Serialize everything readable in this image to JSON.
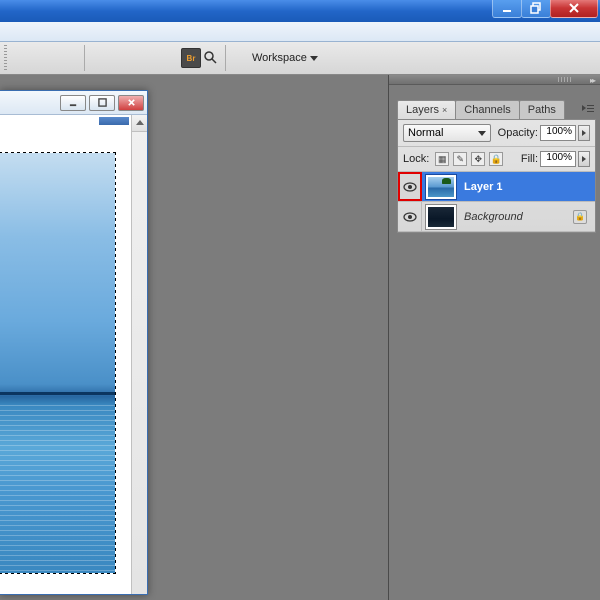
{
  "titlebar": {
    "min": "Minimize",
    "max": "Restore",
    "close": "Close"
  },
  "optionsbar": {
    "bridge_label": "Br",
    "workspace_label": "Workspace"
  },
  "document": {
    "min": "Minimize",
    "max": "Maximize",
    "close": "Close"
  },
  "panel": {
    "tabs": [
      {
        "label": "Layers",
        "active": true
      },
      {
        "label": "Channels",
        "active": false
      },
      {
        "label": "Paths",
        "active": false
      }
    ],
    "blend_mode": "Normal",
    "opacity_label": "Opacity:",
    "opacity_value": "100%",
    "lock_label": "Lock:",
    "fill_label": "Fill:",
    "fill_value": "100%",
    "layers": [
      {
        "name": "Layer 1",
        "selected": true,
        "locked": false,
        "highlight_eye": true,
        "thumb": "sky"
      },
      {
        "name": "Background",
        "selected": false,
        "locked": true,
        "highlight_eye": false,
        "thumb": "dark"
      }
    ]
  }
}
